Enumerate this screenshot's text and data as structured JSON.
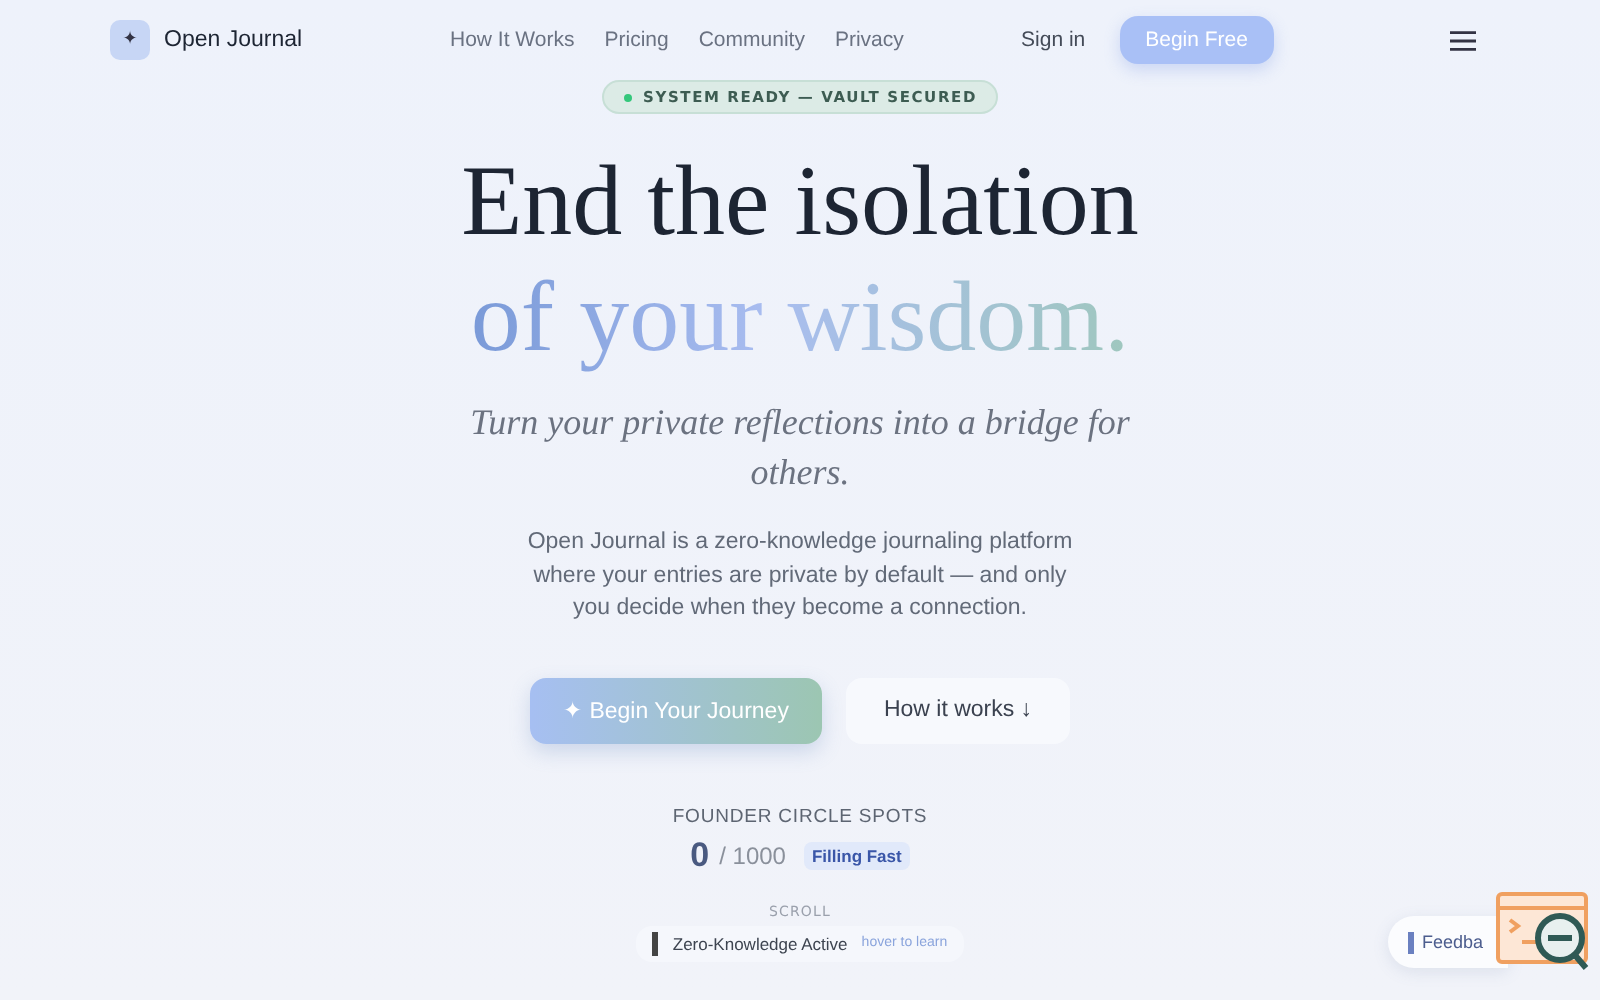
{
  "nav": {
    "brand_icon": "✦",
    "brand": "Open Journal",
    "links": [
      {
        "label": "How It Works"
      },
      {
        "label": "Pricing"
      },
      {
        "label": "Community"
      },
      {
        "label": "Privacy"
      }
    ],
    "sign_in": "Sign in",
    "cta": "Begin Free"
  },
  "status_badge": {
    "text": "SYSTEM READY — VAULT SECURED",
    "color": "#34c77b"
  },
  "hero": {
    "title_line_1": "End the isolation",
    "title_line_2": "of your wisdom.",
    "subtitle": "Turn your private reflections into a bridge for others.",
    "body": "Open Journal is a zero-knowledge journaling platform where your entries are private by default — and only you decide when they become a connection.",
    "primary_button": "✦ Begin Your Journey",
    "secondary_button": "How it works ↓"
  },
  "founder": {
    "label": "FOUNDER CIRCLE SPOTS",
    "count": "0",
    "total": "/ 1000",
    "tag": "Filling Fast"
  },
  "scroll_hint": "SCROLL",
  "zk_pill": {
    "text": "Zero-Knowledge Active",
    "hint": "hover to learn"
  },
  "feedback": {
    "label": "Feedba"
  }
}
